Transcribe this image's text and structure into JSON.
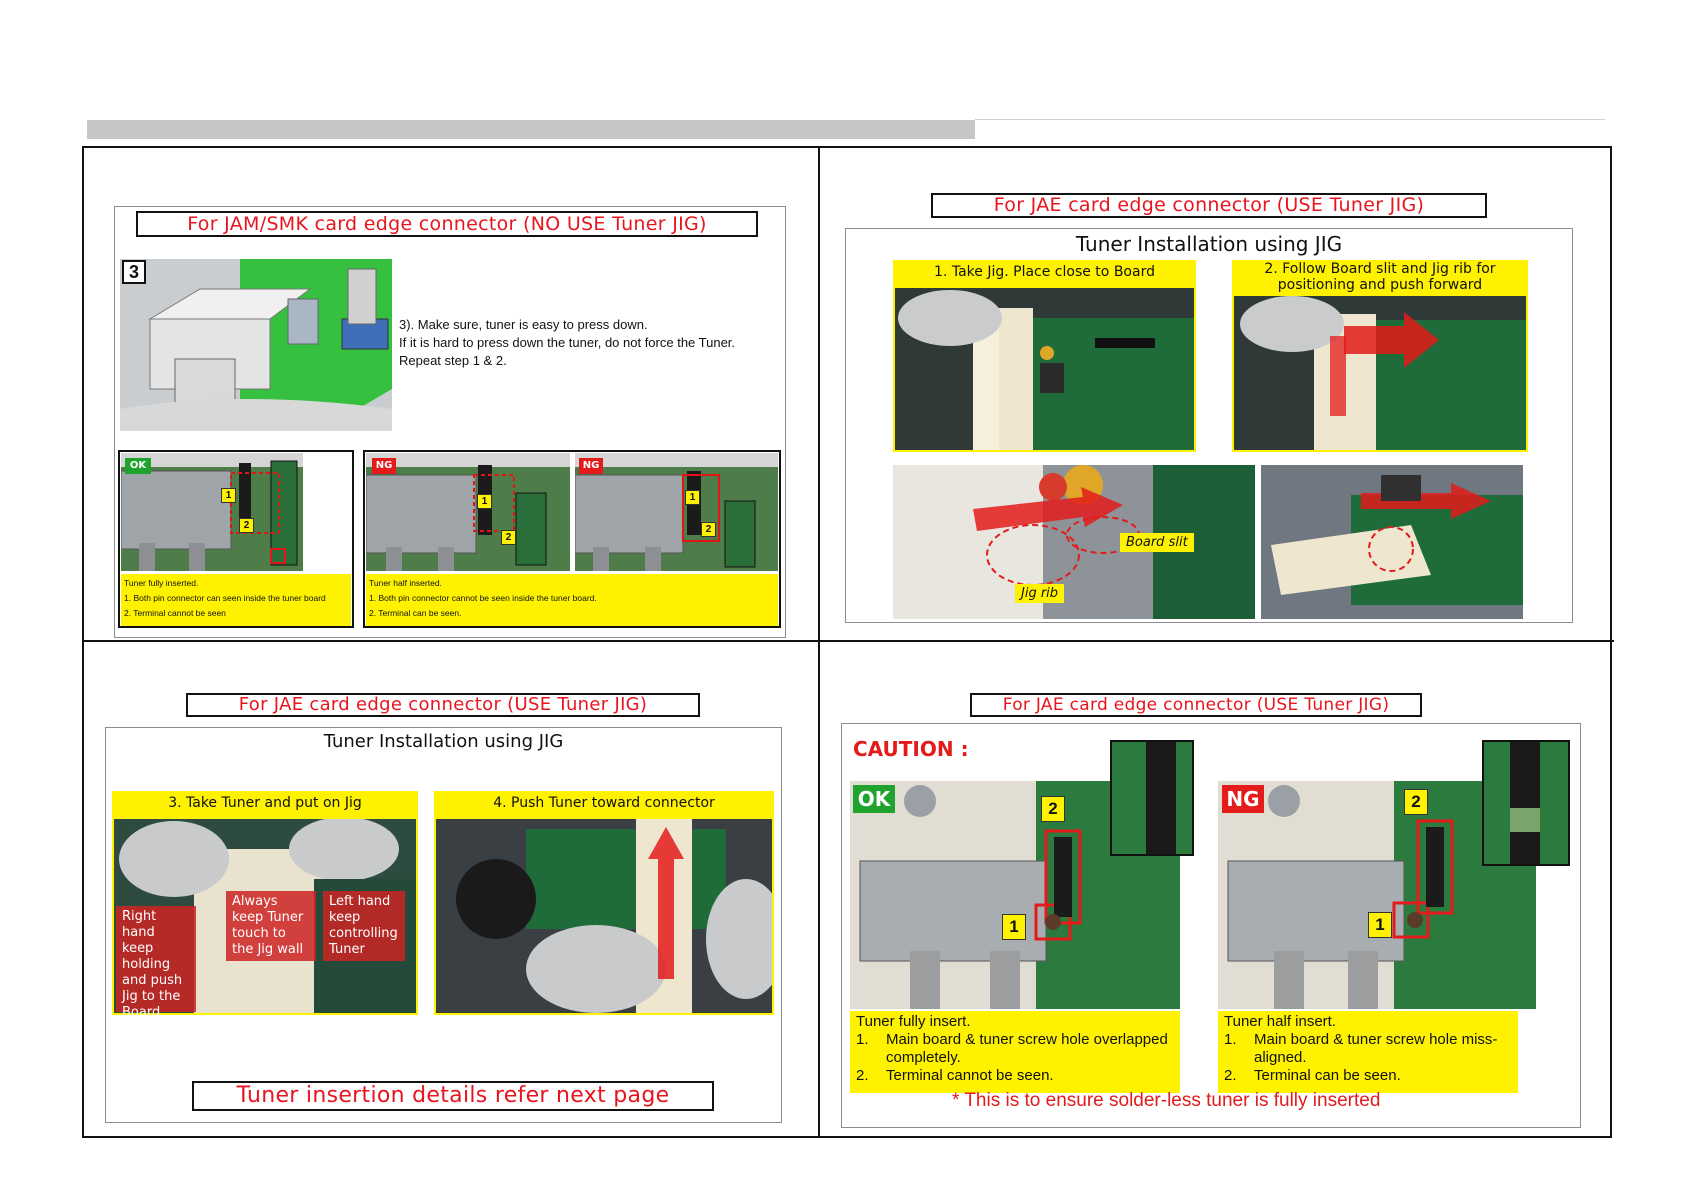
{
  "q1": {
    "title": "For JAM/SMK card edge connector (NO USE Tuner JIG)",
    "step_number": "3",
    "instructions": [
      "3). Make sure, tuner is easy to press down.",
      "If it is hard to press down the tuner, do not force the Tuner.",
      "Repeat step 1 & 2."
    ],
    "ok_panel": {
      "badge": "OK",
      "caption": [
        "Tuner fully inserted.",
        "1. Both pin connector can seen inside the tuner board",
        "2. Terminal cannot be seen"
      ]
    },
    "ng_panel": {
      "badge_left": "NG",
      "badge_right": "NG",
      "caption": [
        "Tuner half inserted.",
        "1. Both pin connector cannot be seen inside the tuner board.",
        "2. Terminal can be seen."
      ]
    },
    "tags": [
      "1",
      "2"
    ]
  },
  "q2": {
    "title": "For JAE card edge connector (USE Tuner JIG)",
    "frame_title": "Tuner Installation using JIG",
    "step1": "1.  Take Jig. Place close to Board",
    "step2": "2.  Follow Board slit and Jig rib for positioning and push forward",
    "board_slit": "Board slit",
    "jig_rib": "Jig rib"
  },
  "q3": {
    "title": "For JAE card edge connector (USE Tuner JIG)",
    "frame_title": "Tuner Installation using JIG",
    "step3": "3.  Take Tuner and put on Jig",
    "step4": "4.   Push Tuner toward connector",
    "label_right_hand": "Right hand keep holding and push Jig to the Board",
    "label_always": "Always keep Tuner touch to the Jig wall",
    "label_left_hand": "Left hand keep controlling Tuner",
    "footer": "Tuner insertion details refer next page"
  },
  "q4": {
    "title": "For JAE card edge connector (USE Tuner JIG)",
    "caution": "CAUTION :",
    "ok_badge": "OK",
    "ng_badge": "NG",
    "tag1": "1",
    "tag2": "2",
    "ok_caption": {
      "head": "Tuner fully insert.",
      "item1_num": "1.",
      "item1": "Main board & tuner screw hole overlapped completely.",
      "item2_num": "2.",
      "item2": "Terminal cannot be seen."
    },
    "ng_caption": {
      "head": "Tuner half insert.",
      "item1_num": "1.",
      "item1": "Main board & tuner screw hole miss-aligned.",
      "item2_num": "2.",
      "item2": "Terminal can be seen."
    },
    "ensure": "* This is to ensure solder-less tuner is fully inserted"
  },
  "colors": {
    "accent_red": "#e8141e",
    "highlight_yellow": "#fff200",
    "ok_green": "#1fa32e",
    "ng_red": "#e31b1b"
  }
}
